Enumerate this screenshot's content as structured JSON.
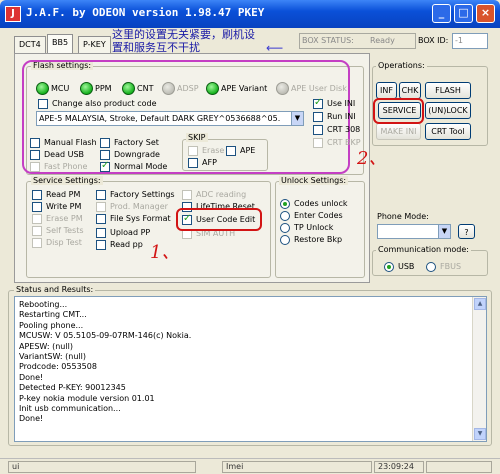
{
  "app": {
    "title": "J.A.F. by ODEON version 1.98.47 PKEY",
    "icon": "J",
    "min": "_",
    "max": "□",
    "close": "×"
  },
  "tabs": [
    "DCT4",
    "BB5",
    "P-KEY"
  ],
  "note": "这里的设置无关紧要，刷机设置和服务互不干扰",
  "box_status": {
    "label": "BOX STATUS:",
    "value": "Ready"
  },
  "box_id": {
    "label": "BOX ID:",
    "value": "-1"
  },
  "flash": {
    "title": "Flash settings:",
    "leds": [
      {
        "label": "MCU",
        "on": true
      },
      {
        "label": "PPM",
        "on": true
      },
      {
        "label": "CNT",
        "on": true
      },
      {
        "label": "ADSP",
        "on": false
      },
      {
        "label": "APE Variant",
        "on": true
      },
      {
        "label": "APE User Disk",
        "on": false
      }
    ],
    "change_product": "Change also product code",
    "product_value": "APE-5 MALAYSIA, Stroke, Default DARK GREY^0536688^05.",
    "use_ini": "Use INI",
    "run_ini": "Run INI",
    "crt308": "CRT 308",
    "crtbkp": "CRT BKP",
    "manual_flash": "Manual Flash",
    "factory_set": "Factory Set",
    "dead_usb": "Dead USB",
    "downgrade": "Downgrade",
    "fast_phone": "Fast Phone",
    "normal_mode": "Normal Mode",
    "skip": {
      "title": "SKIP",
      "erase": "Erase",
      "ape": "APE",
      "afp": "AFP"
    }
  },
  "operations": {
    "title": "Operations:",
    "inf": "INF",
    "chk": "CHK",
    "flash": "FLASH",
    "service": "SERVICE",
    "unlock": "(UN)LOCK",
    "make_ini": "MAKE INI",
    "crt_tool": "CRT Tool"
  },
  "service": {
    "title": "Service Settings:",
    "col1": [
      "Read PM",
      "Write PM",
      "Erase PM",
      "Self Tests",
      "Disp Test"
    ],
    "col2": [
      "Factory Settings",
      "Prod. Manager",
      "File Sys Format",
      "Upload PP",
      "Read pp"
    ],
    "col3": [
      "ADC reading",
      "LifeTime Reset",
      "User Code Edit",
      "SIM AUTH"
    ]
  },
  "unlock": {
    "title": "Unlock Settings:",
    "options": [
      "Codes unlock",
      "Enter Codes",
      "TP Unlock",
      "Restore Bkp"
    ]
  },
  "phone_mode": {
    "title": "Phone Mode:",
    "help": "?"
  },
  "comm": {
    "title": "Communication mode:",
    "usb": "USB",
    "fbus": "FBUS"
  },
  "annotations": {
    "one": "1、",
    "two": "2、"
  },
  "status": {
    "title": "Status and Results:",
    "lines": [
      "Rebooting...",
      "Restarting CMT...",
      "Pooling phone...",
      "MCUSW: V 05.5105-09-07RM-146(c) Nokia.",
      "APESW: (null)",
      "VariantSW: (null)",
      "Prodcode: 0553508",
      "Done!",
      "Detected P-KEY: 90012345",
      "P-key nokia module version 01.01",
      "Init usb communication...",
      "Done!"
    ]
  },
  "statusbar": {
    "left": "ui",
    "mid": "Imei",
    "time": "23:09:24"
  }
}
